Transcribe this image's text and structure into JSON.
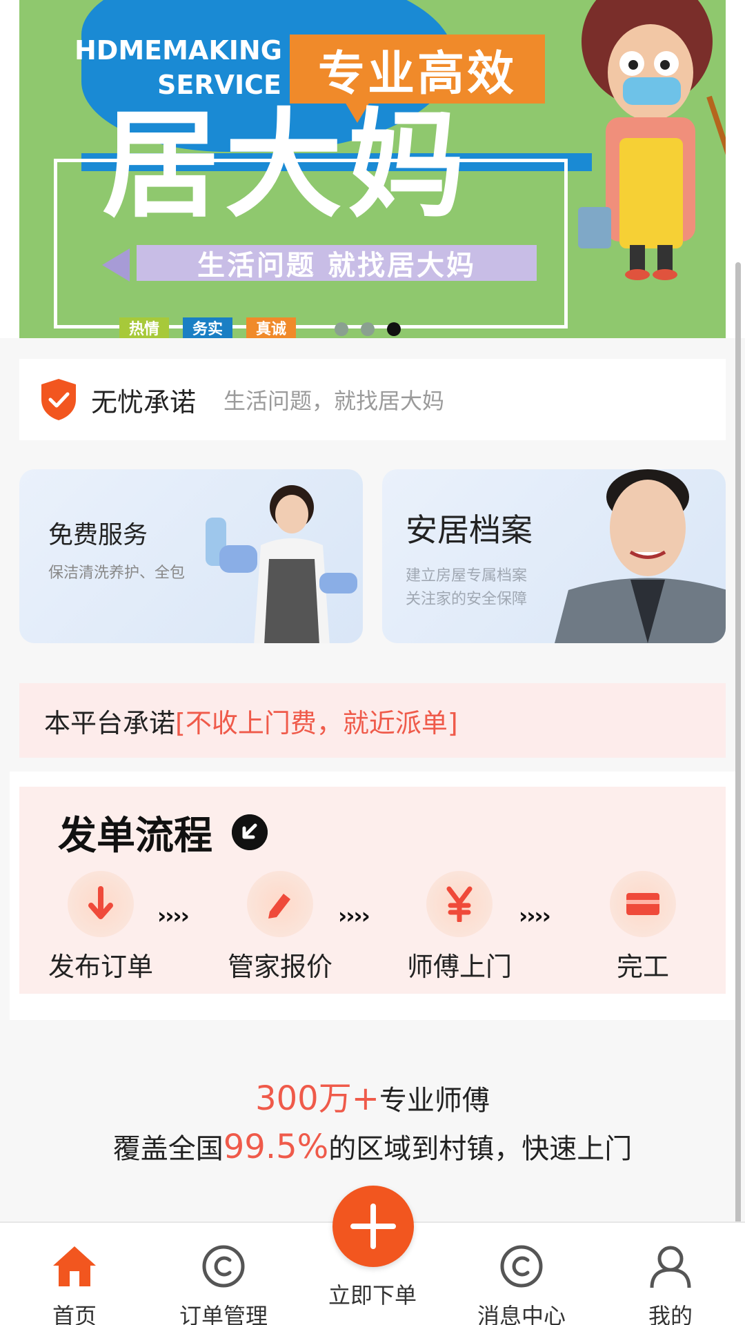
{
  "banner": {
    "en_title": "HDMEMAKING SERVICE",
    "tag": "专业高效",
    "headline": "居大妈",
    "subline": "生活问题  就找居大妈",
    "chips": [
      {
        "label": "热情",
        "color": "#a7c93a"
      },
      {
        "label": "务实",
        "color": "#1a7fc4"
      },
      {
        "label": "真诚",
        "color": "#f08a2a"
      }
    ],
    "dots": {
      "count": 3,
      "active_index": 2
    }
  },
  "promise": {
    "icon": "shield-check-icon",
    "title": "无忧承诺",
    "subtitle": "生活问题，就找居大妈"
  },
  "cards": {
    "left": {
      "title": "免费服务",
      "lines": [
        "保洁清洗养护、全包"
      ]
    },
    "right": {
      "title": "安居档案",
      "lines": [
        "建立房屋专属档案",
        "关注家的安全保障"
      ]
    }
  },
  "platform": {
    "prefix": "本平台承诺",
    "highlight": "[不收上门费，就近派单]"
  },
  "flow": {
    "title": "发单流程",
    "steps": [
      {
        "label": "发布订单",
        "icon": "arrow-down-icon"
      },
      {
        "label": "管家报价",
        "icon": "pencil-icon"
      },
      {
        "label": "师傅上门",
        "icon": "yen-icon"
      },
      {
        "label": "完工",
        "icon": "card-icon"
      }
    ],
    "separator": "››››"
  },
  "stats": {
    "line1_number": "300万+",
    "line1_text": "专业师傅",
    "line2_prefix": "覆盖全国",
    "line2_number": "99.5%",
    "line2_suffix": "的区域到村镇，快速上门"
  },
  "tabbar": {
    "items": [
      {
        "label": "首页",
        "icon": "home-icon",
        "active": true
      },
      {
        "label": "订单管理",
        "icon": "order-icon"
      },
      {
        "label": "立即下单",
        "icon": "plus-icon"
      },
      {
        "label": "消息中心",
        "icon": "message-icon"
      },
      {
        "label": "我的",
        "icon": "user-icon"
      }
    ]
  },
  "colors": {
    "accent": "#f2561f",
    "highlight_red": "#ef5a4a",
    "banner_green": "#8fc86e",
    "banner_blue": "#1a8ad4"
  }
}
